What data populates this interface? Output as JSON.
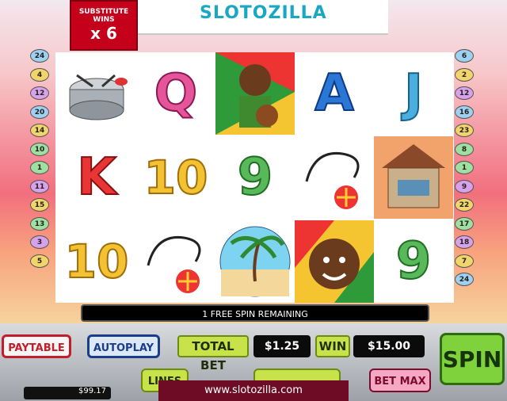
{
  "brand": {
    "logo_text": "SLOTOZILLA",
    "footer_url": "www.slotozilla.com"
  },
  "substitute_wins": {
    "title": "SUBSTITUTE WINS",
    "multiplier": "x 6"
  },
  "paylines_left": [
    "24",
    "4",
    "12",
    "20",
    "14",
    "10",
    "1",
    "11",
    "15",
    "13",
    "3",
    "5"
  ],
  "paylines_right": [
    "6",
    "2",
    "12",
    "16",
    "23",
    "8",
    "1",
    "9",
    "22",
    "17",
    "18",
    "7",
    "24"
  ],
  "reels": [
    [
      "steel-drum",
      "K",
      "10"
    ],
    [
      "Q",
      "10",
      "headphones-ball"
    ],
    [
      "rasta-man-ball",
      "9",
      "palm-beach"
    ],
    [
      "A",
      "headphones-ball",
      "rasta-man-face"
    ],
    [
      "J",
      "hut",
      "9"
    ]
  ],
  "status": {
    "free_spins": "1 FREE SPIN REMAINING"
  },
  "controls": {
    "paytable": "PAYTABLE",
    "autoplay": "AUTOPLAY",
    "total_bet_label": "TOTAL BET",
    "total_bet_value": "$1.25",
    "win_label": "WIN",
    "win_value": "$15.00",
    "spin": "SPIN",
    "lines_label": "LINES",
    "bet_max": "BET MAX",
    "coin_label": "",
    "balance": "$99.17"
  },
  "colors": {
    "accent": "#c5001b",
    "spin_green": "#7fd23c"
  }
}
